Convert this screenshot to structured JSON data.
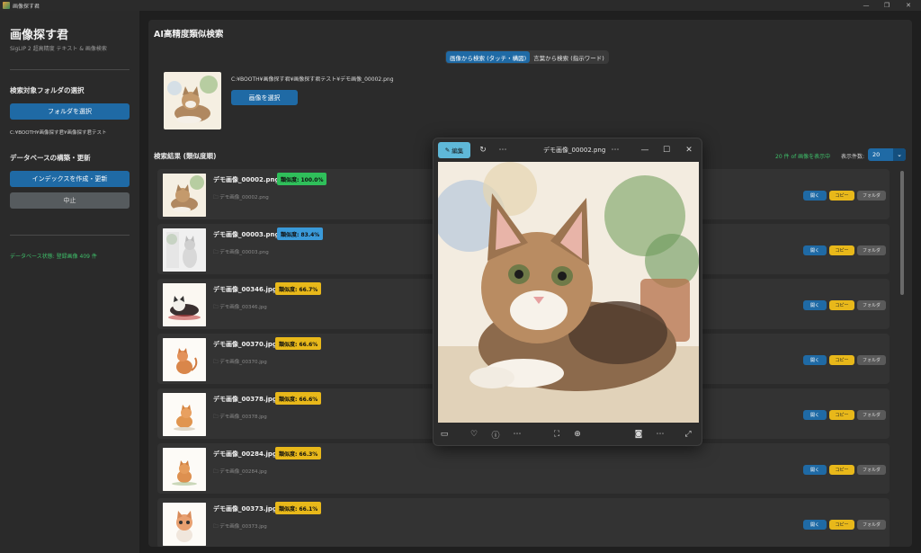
{
  "window": {
    "title": "画像探す君",
    "minimize": "—",
    "restore": "❐",
    "close": "✕"
  },
  "sidebar": {
    "app_title": "画像探す君",
    "subtitle": "SigLIP 2 超高精度 テキスト & 画像検索",
    "folder_section": "検索対象フォルダの選択",
    "select_folder": "フォルダを選択",
    "folder_path": "C:¥BOOTH¥画像探す君¥画像探す君テスト",
    "db_section": "データベースの構築・更新",
    "build_index": "インデックスを作成・更新",
    "stop": "中止",
    "db_status": "データベース状態: 登録画像 409 件"
  },
  "main": {
    "title": "AI高精度類似検索",
    "tabs": [
      {
        "label": "画像から検索 (タッチ・構図)",
        "active": true
      },
      {
        "label": "言葉から検索 (指示ワード)",
        "active": false
      }
    ],
    "query_path": "C:¥BOOTH¥画像探す君¥画像探す君テスト¥デモ画像_00002.png",
    "select_image": "画像を選択",
    "results_title": "検索結果 (類似度順)",
    "results_count": "20 件 of 画像を表示中",
    "display_count_label": "表示件数:",
    "display_count": "20"
  },
  "results": [
    {
      "name": "デモ画像_00002.png",
      "score": "類似度: 100.0%",
      "color": "#2fbf5a",
      "path": "デモ画像_00002.png"
    },
    {
      "name": "デモ画像_00003.png",
      "score": "類似度: 83.4%",
      "color": "#3a9ad9",
      "path": "デモ画像_00003.png"
    },
    {
      "name": "デモ画像_00346.jpg",
      "score": "類似度: 66.7%",
      "color": "#e8b81a",
      "path": "デモ画像_00346.jpg"
    },
    {
      "name": "デモ画像_00370.jpg",
      "score": "類似度: 66.6%",
      "color": "#e8b81a",
      "path": "デモ画像_00370.jpg"
    },
    {
      "name": "デモ画像_00378.jpg",
      "score": "類似度: 66.6%",
      "color": "#e8b81a",
      "path": "デモ画像_00378.jpg"
    },
    {
      "name": "デモ画像_00284.jpg",
      "score": "類似度: 66.3%",
      "color": "#e8b81a",
      "path": "デモ画像_00284.jpg"
    },
    {
      "name": "デモ画像_00373.jpg",
      "score": "類似度: 66.1%",
      "color": "#e8b81a",
      "path": "デモ画像_00373.jpg"
    }
  ],
  "actions": {
    "open": "開く",
    "copy": "コピー",
    "folder": "フォルダ"
  },
  "viewer": {
    "edit": "編集",
    "title": "デモ画像_00002.png"
  }
}
